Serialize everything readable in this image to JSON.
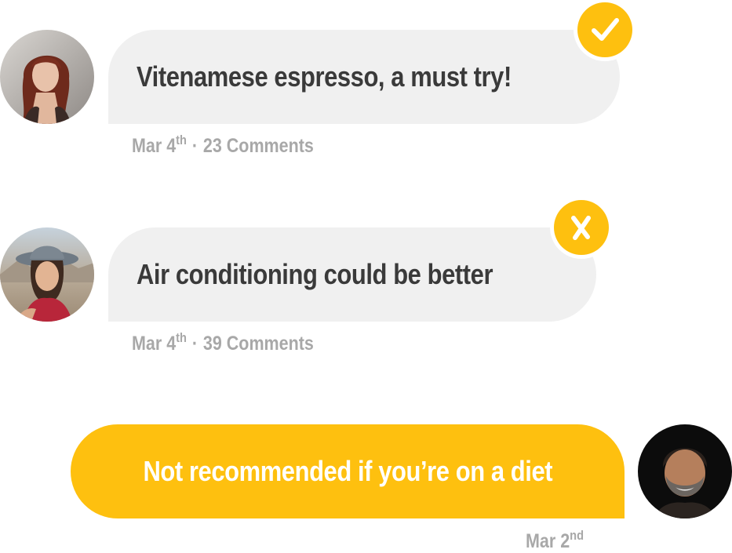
{
  "posts": [
    {
      "text": "Vitenamese espresso, a must try!",
      "date_main": "Mar 4",
      "date_suffix": "th",
      "separator": "·",
      "comments": "23 Comments",
      "status_icon": "checkmark-icon",
      "avatar": "woman-red-hair-avatar"
    },
    {
      "text": "Air conditioning could be better",
      "date_main": "Mar 4",
      "date_suffix": "th",
      "separator": "·",
      "comments": "39 Comments",
      "status_icon": "x-mark-icon",
      "avatar": "woman-hat-avatar"
    }
  ],
  "reply": {
    "text": "Not recommended if you’re on a diet",
    "date_main": "Mar 2",
    "date_suffix": "nd",
    "avatar": "bearded-man-avatar"
  },
  "colors": {
    "accent": "#fec00f",
    "bubble_grey": "#f0f0f0",
    "text_dark": "#3a3a3a",
    "meta_grey": "#a8a8a8"
  }
}
